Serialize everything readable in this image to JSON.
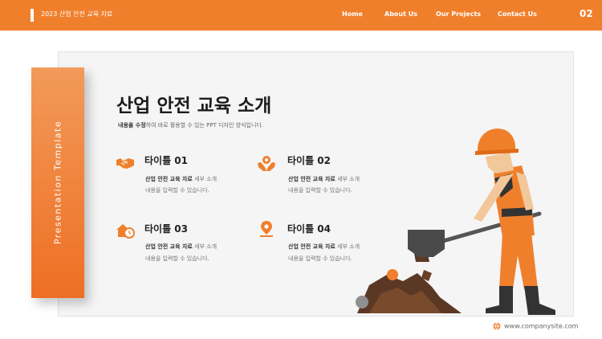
{
  "header": {
    "title": "2023 산업 안전 교육 자료",
    "nav": [
      "Home",
      "About Us",
      "Our Projects",
      "Contact Us"
    ],
    "page_number": "02"
  },
  "sidebar": {
    "vertical_text": "Presentation Template"
  },
  "main": {
    "title": "산업 안전 교육 소개",
    "desc_bold": "내용을 수정",
    "desc_rest": "하여 바로 활용할 수 있는 PPT 디자인 양식입니다."
  },
  "items": [
    {
      "title": "타이틀 01",
      "line1_bold": "산업 안전 교육 자료",
      "line1_rest": " 세부 소개",
      "line2": "내용을 입력할 수 있습니다.",
      "icon": "handshake-icon"
    },
    {
      "title": "타이틀 02",
      "line1_bold": "산업 안전 교육 자료",
      "line1_rest": " 세부 소개",
      "line2": "내용을 입력할 수 있습니다.",
      "icon": "hands-gear-icon"
    },
    {
      "title": "타이틀 03",
      "line1_bold": "산업 안전 교육 자료",
      "line1_rest": " 세부 소개",
      "line2": "내용을 입력할 수 있습니다.",
      "icon": "home-clock-icon"
    },
    {
      "title": "타이틀 04",
      "line1_bold": "산업 안전 교육 자료",
      "line1_rest": " 세부 소개",
      "line2": "내용을 입력할 수 있습니다.",
      "icon": "location-pin-icon"
    }
  ],
  "footer": {
    "url": "www.companysite.com"
  },
  "colors": {
    "accent": "#f07f2c",
    "sidebar_top": "#f29a5a",
    "sidebar_bottom": "#ee6f23"
  }
}
